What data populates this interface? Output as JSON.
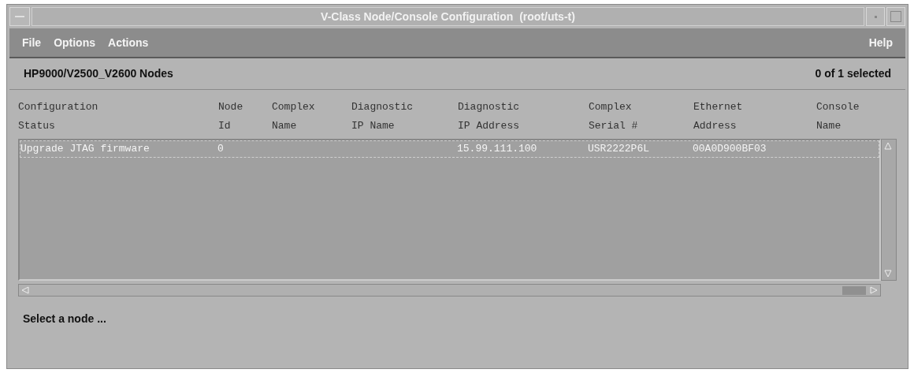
{
  "window": {
    "title": "V-Class Node/Console Configuration  (root/uts-t)"
  },
  "menu_bar": {
    "left": [
      "File",
      "Options",
      "Actions"
    ],
    "right": [
      "Help"
    ]
  },
  "header": {
    "title": "HP9000/V2500_V2600 Nodes",
    "selection_count": "0 of 1 selected"
  },
  "table": {
    "columns": [
      "Configuration\nStatus",
      "Node\nId",
      "Complex\nName",
      "Diagnostic\nIP Name",
      "Diagnostic\nIP Address",
      "Complex\nSerial #",
      "Ethernet\nAddress",
      "Console\nName"
    ],
    "rows": [
      {
        "selected": false,
        "cells": [
          "Upgrade JTAG firmware",
          "0",
          null,
          null,
          "15.99.111.100",
          "USR2222P6L",
          "00A0D900BF03",
          null
        ]
      }
    ]
  },
  "status_bar": {
    "message": "Select a node ..."
  }
}
